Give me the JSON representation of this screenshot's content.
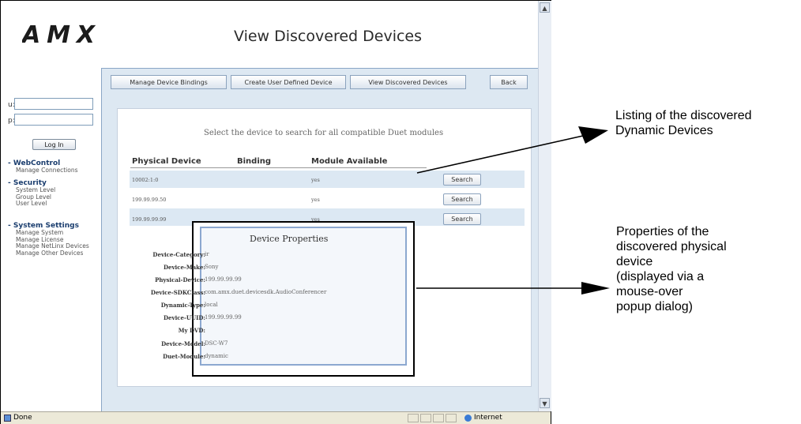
{
  "logo_text": "AMX",
  "page_title": "View Discovered Devices",
  "login": {
    "user_label": "u:",
    "pass_label": "p:",
    "button": "Log In"
  },
  "nav": {
    "sections": [
      {
        "title": "- WebControl",
        "items": [
          "Manage Connections"
        ]
      },
      {
        "title": "- Security",
        "items": [
          "System Level",
          "Group Level",
          "User Level"
        ]
      },
      {
        "title": "- System Settings",
        "items": [
          "Manage System",
          "Manage License",
          "Manage NetLinx Devices",
          "Manage Other Devices"
        ]
      }
    ]
  },
  "tabs": [
    "Manage Device Bindings",
    "Create User Defined Device",
    "View Discovered Devices",
    "Back"
  ],
  "prompt": "Select the device to search for all compatible Duet modules",
  "table": {
    "headers": [
      "Physical Device",
      "Binding",
      "Module Available"
    ],
    "rows": [
      {
        "device": "10002:1:0",
        "binding": "",
        "module": "yes",
        "action": "Search"
      },
      {
        "device": "199.99.99.50",
        "binding": "",
        "module": "yes",
        "action": "Search"
      },
      {
        "device": "199.99.99.99",
        "binding": "",
        "module": "yes",
        "action": "Search"
      }
    ]
  },
  "popup": {
    "title": "Device Properties",
    "properties": [
      {
        "key": "Device-Category:",
        "value": "ir"
      },
      {
        "key": "Device-Make:",
        "value": "Sony"
      },
      {
        "key": "Physical-Device:",
        "value": "199.99.99.99"
      },
      {
        "key": "Device-SDKClass:",
        "value": "com.amx.duet.devicesdk.AudioConferencer"
      },
      {
        "key": "Dynamic-Type:",
        "value": "local"
      },
      {
        "key": "Device-UUID:",
        "value": "199.99.99.99"
      },
      {
        "key": "My DVD:",
        "value": ""
      },
      {
        "key": "Device-Model:",
        "value": "DSC-W7"
      },
      {
        "key": "Duet-Module:",
        "value": "dynamic"
      }
    ]
  },
  "statusbar": {
    "left": "Done",
    "zone": "Internet"
  },
  "annotations": {
    "listing": [
      "Listing of the discovered",
      "Dynamic Devices"
    ],
    "properties": [
      "Properties of the",
      "discovered physical",
      "device",
      "(displayed via a",
      "mouse-over",
      "popup dialog)"
    ]
  },
  "colors": {
    "panel": "#dde8f2",
    "row_alt": "#dce8f3",
    "nav_head": "#1a3d6e",
    "popup_border": "#8ca8d0"
  }
}
